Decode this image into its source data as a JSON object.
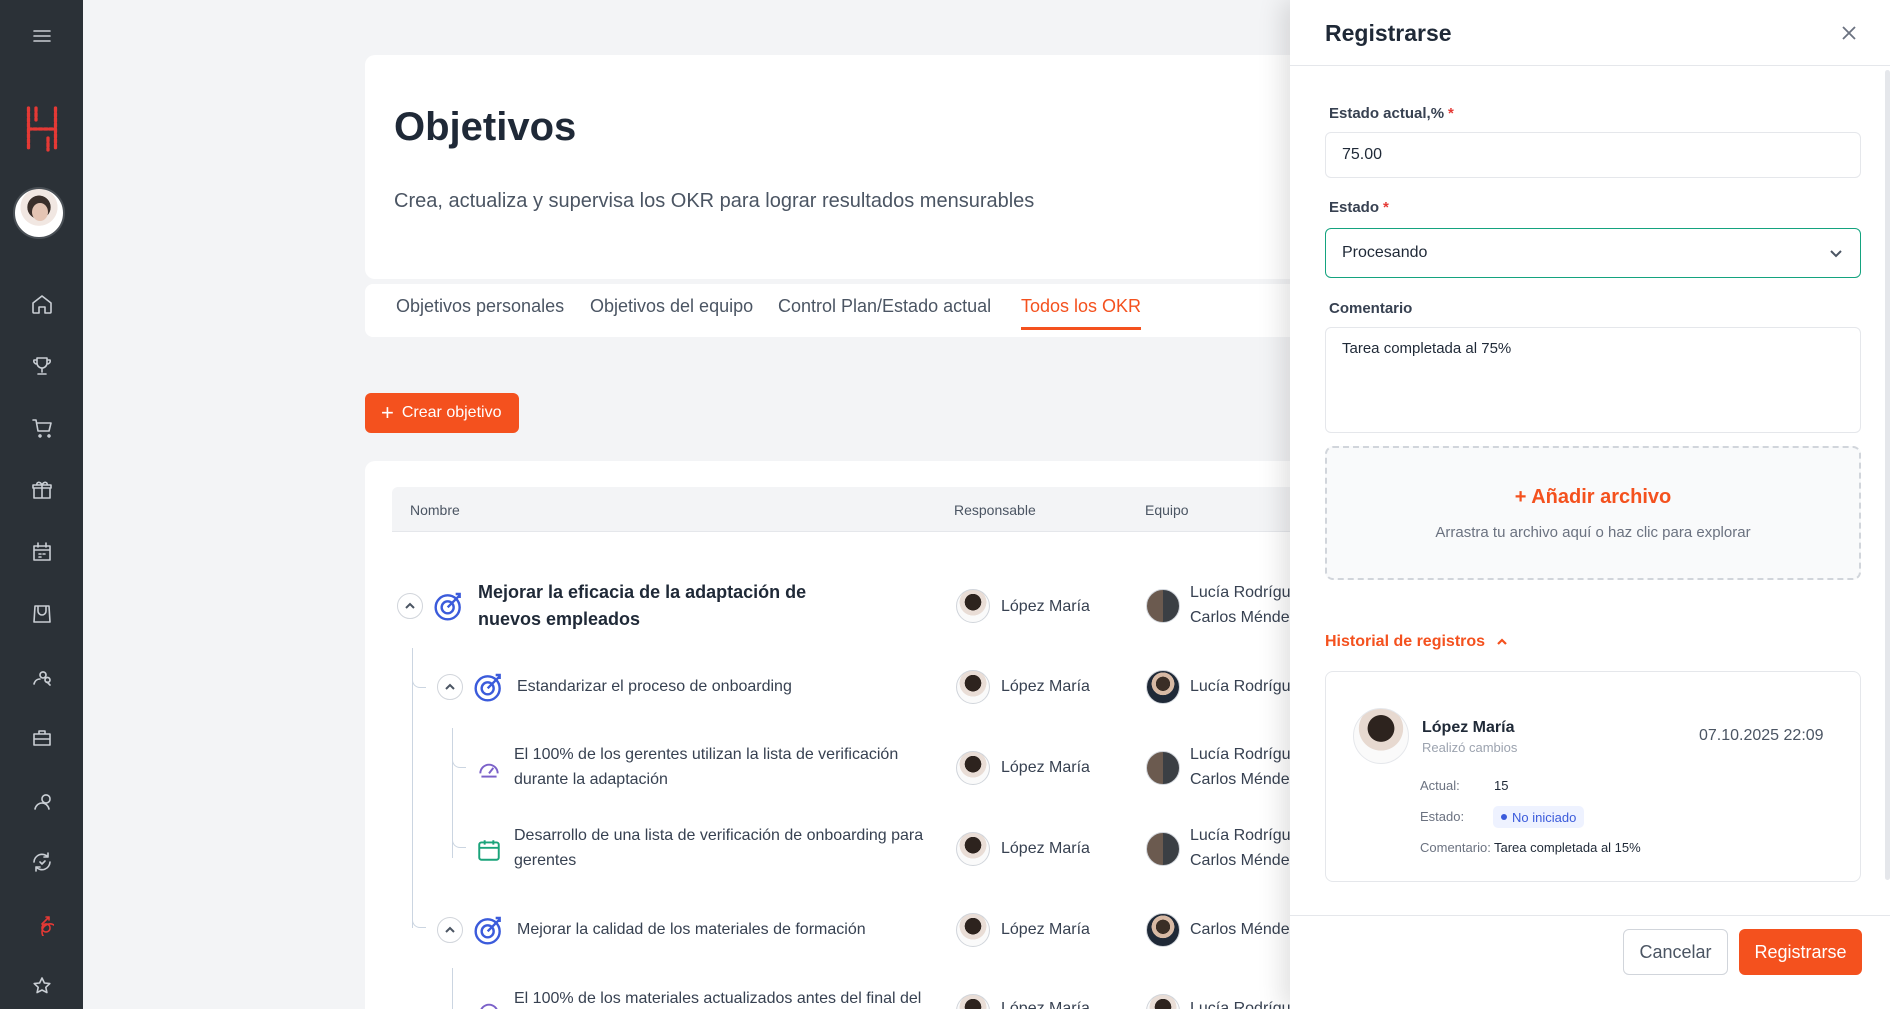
{
  "header": {
    "title": "Objetivos",
    "subtitle": "Crea, actualiza y supervisa los OKR para lograr resultados mensurables"
  },
  "tabs": [
    {
      "label": "Objetivos personales"
    },
    {
      "label": "Objetivos del equipo"
    },
    {
      "label": "Control Plan/Estado actual"
    },
    {
      "label": "Todos los OKR",
      "active": true
    }
  ],
  "create_button": {
    "label": "Crear objetivo"
  },
  "table": {
    "columns": [
      "Nombre",
      "Responsable",
      "Equipo"
    ],
    "rows": [
      {
        "name": "Mejorar la eficacia de la adaptación de nuevos empleados",
        "owner": "López María",
        "team": [
          "Lucía Rodrígu...",
          "Carlos Ménde..."
        ],
        "icon": "target-icon"
      },
      {
        "name": "Estandarizar el proceso de onboarding",
        "owner": "López María",
        "team": [
          "Lucía Rodrígu..."
        ],
        "icon": "target-icon"
      },
      {
        "name": "El 100% de los gerentes utilizan la lista de verificación durante la adaptación",
        "owner": "López María",
        "team": [
          "Lucía Rodrígu...",
          "Carlos Ménde..."
        ],
        "icon": "gauge-icon"
      },
      {
        "name": "Desarrollo de una lista de verificación de onboarding para gerentes",
        "owner": "López María",
        "team": [
          "Lucía Rodrígu...",
          "Carlos Ménde..."
        ],
        "icon": "calendar-icon"
      },
      {
        "name": "Mejorar la calidad de los materiales de formación",
        "owner": "López María",
        "team": [
          "Carlos Ménde..."
        ],
        "icon": "target-icon"
      },
      {
        "name": "El 100% de los materiales actualizados antes del final del",
        "owner": "López María",
        "team": [
          "Lucía Rodrígu..."
        ],
        "icon": "gauge-icon"
      }
    ]
  },
  "drawer": {
    "title": "Registrarse",
    "current_label": "Estado actual,%",
    "current_value": "75.00",
    "status_label": "Estado",
    "status_value": "Procesando",
    "comment_label": "Comentario",
    "comment_value": "Tarea completada al 75%",
    "upload_title": "Añadir archivo",
    "upload_hint": "Arrastra tu archivo aquí o haz clic para explorar",
    "history_label": "Historial de registros",
    "history": {
      "name": "López María",
      "action": "Realizó cambios",
      "date": "07.10.2025 22:09",
      "current_key": "Actual:",
      "current_value": "15",
      "status_key": "Estado:",
      "status_value": "No iniciado",
      "comment_key": "Comentario:",
      "comment_value": "Tarea completada al 15%"
    },
    "cancel_label": "Cancelar",
    "submit_label": "Registrarse"
  },
  "colors": {
    "accent": "#f4511e",
    "sidebar": "#2b3137",
    "select_border": "#14a37f",
    "badge": "#3b5bdb"
  }
}
